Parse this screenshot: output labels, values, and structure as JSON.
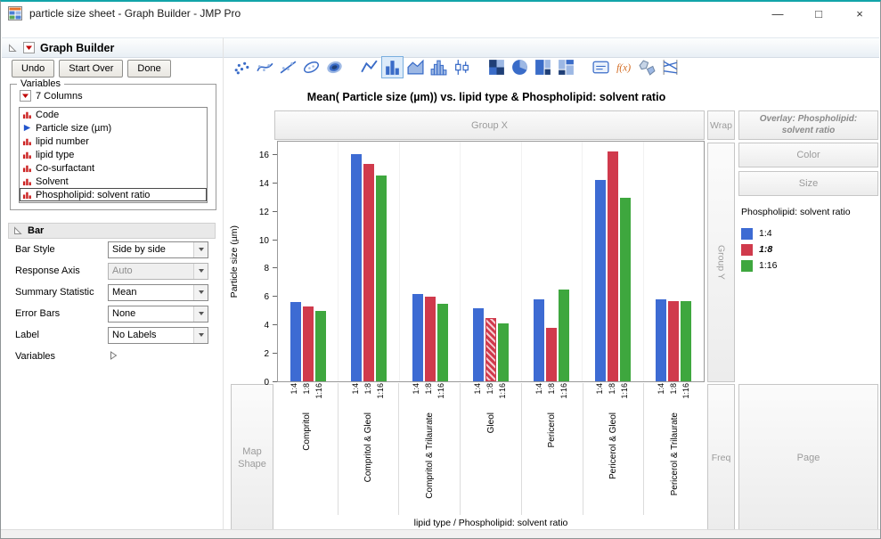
{
  "window": {
    "title": "particle size sheet - Graph Builder - JMP Pro",
    "controls": {
      "minimize": "—",
      "maximize": "□",
      "close": "×"
    }
  },
  "header": {
    "title": "Graph Builder"
  },
  "action_buttons": [
    "Undo",
    "Start Over",
    "Done"
  ],
  "element_toolbar": {
    "groups": [
      [
        {
          "name": "points"
        },
        {
          "name": "smoother"
        },
        {
          "name": "line-of-fit"
        },
        {
          "name": "ellipse"
        },
        {
          "name": "contour"
        }
      ],
      [
        {
          "name": "line"
        },
        {
          "name": "bar",
          "selected": true
        },
        {
          "name": "area"
        },
        {
          "name": "histogram"
        },
        {
          "name": "box-plot"
        }
      ],
      [
        {
          "name": "heatmap"
        },
        {
          "name": "pie"
        },
        {
          "name": "treemap"
        },
        {
          "name": "mosaic"
        }
      ],
      [
        {
          "name": "caption-box"
        },
        {
          "name": "formula"
        },
        {
          "name": "map-shapes"
        },
        {
          "name": "parallel-plot"
        }
      ]
    ]
  },
  "variables_panel": {
    "title": "Variables",
    "columns_label": "7 Columns",
    "columns": [
      {
        "name": "Code",
        "type": "nominal"
      },
      {
        "name": "Particle size (µm)",
        "type": "continuous"
      },
      {
        "name": "lipid number",
        "type": "nominal"
      },
      {
        "name": "lipid type",
        "type": "nominal"
      },
      {
        "name": "Co-surfactant",
        "type": "nominal"
      },
      {
        "name": "Solvent",
        "type": "nominal"
      },
      {
        "name": "Phospholipid: solvent ratio",
        "type": "nominal",
        "selected": true
      }
    ]
  },
  "bar_panel": {
    "title": "Bar",
    "settings": [
      {
        "label": "Bar Style",
        "value": "Side by side",
        "enabled": true
      },
      {
        "label": "Response Axis",
        "value": "Auto",
        "enabled": false
      },
      {
        "label": "Summary Statistic",
        "value": "Mean",
        "enabled": true
      },
      {
        "label": "Error Bars",
        "value": "None",
        "enabled": true
      },
      {
        "label": "Label",
        "value": "No Labels",
        "enabled": true
      }
    ],
    "variables_label": "Variables"
  },
  "zones": {
    "group_x": "Group X",
    "wrap": "Wrap",
    "overlay": "Overlay: Phospholipid: solvent ratio",
    "color": "Color",
    "size": "Size",
    "group_y": "Group Y",
    "map_shape": "Map Shape",
    "freq": "Freq",
    "page": "Page"
  },
  "legend": {
    "title": "Phospholipid: solvent ratio",
    "items": [
      {
        "label": "1:4",
        "color": "#3D6BD3",
        "italic": false
      },
      {
        "label": "1:8",
        "color": "#D03A4C",
        "italic": true
      },
      {
        "label": "1:16",
        "color": "#3EA73E",
        "italic": false
      }
    ]
  },
  "chart_data": {
    "type": "bar",
    "title": "Mean( Particle size (µm)) vs. lipid type & Phospholipid: solvent ratio",
    "xlabel": "lipid type / Phospholipid: solvent ratio",
    "ylabel": "Particle size (µm)",
    "ylim": [
      0,
      17
    ],
    "yticks": [
      0,
      2,
      4,
      6,
      8,
      10,
      12,
      14,
      16
    ],
    "grid": false,
    "legend_position": "right",
    "categories": [
      "Compritol",
      "Compritol & Gleol",
      "Compritol & Trilaurate",
      "Gleol",
      "Pericerol",
      "Pericerol & Gleol",
      "Pericerol & Trilaurate"
    ],
    "series": [
      {
        "name": "1:4",
        "color": "#3D6BD3",
        "values": [
          5.6,
          16.1,
          6.2,
          5.2,
          5.8,
          14.3,
          5.8
        ]
      },
      {
        "name": "1:8",
        "color": "#D03A4C",
        "values": [
          5.3,
          15.4,
          6.0,
          4.5,
          3.8,
          16.3,
          5.7
        ]
      },
      {
        "name": "1:16",
        "color": "#3EA73E",
        "values": [
          5.0,
          14.6,
          5.5,
          4.1,
          6.5,
          13.0,
          5.7
        ]
      }
    ],
    "highlighted": {
      "category": "Gleol",
      "series": "1:8"
    }
  }
}
